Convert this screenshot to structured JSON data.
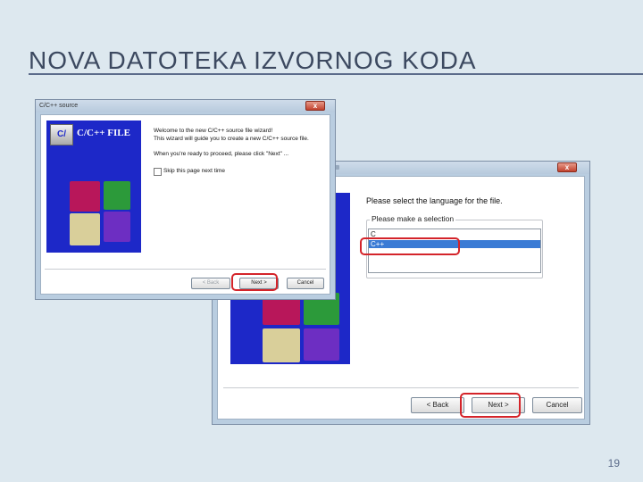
{
  "slide": {
    "title": "NOVA DATOTEKA IZVORNOG KODA",
    "page_number": "19"
  },
  "window_front": {
    "title": "C/C++ source",
    "close_glyph": "x",
    "logo_badge": "C/",
    "logo_text": "C/C++ FILE",
    "welcome_line1": "Welcome to the new C/C++ source file wizard!",
    "welcome_line2": "This wizard will guide you to create a new C/C++ source file.",
    "welcome_line3": "When you're ready to proceed, please click \"Next\" ...",
    "skip_label": "Skip this page next time",
    "back_label": "< Back",
    "next_label": "Next >",
    "cancel_label": "Cancel"
  },
  "window_back": {
    "close_glyph": "x",
    "prompt": "Please select the language for the file.",
    "group_label": "Please make a selection",
    "options": [
      "C",
      "C++"
    ],
    "selected_option": "C++",
    "back_label": "< Back",
    "next_label": "Next >",
    "cancel_label": "Cancel"
  },
  "colors": {
    "highlight": "#d4242a",
    "wizard_blue": "#1d28c8",
    "title_text": "#3c4960"
  }
}
